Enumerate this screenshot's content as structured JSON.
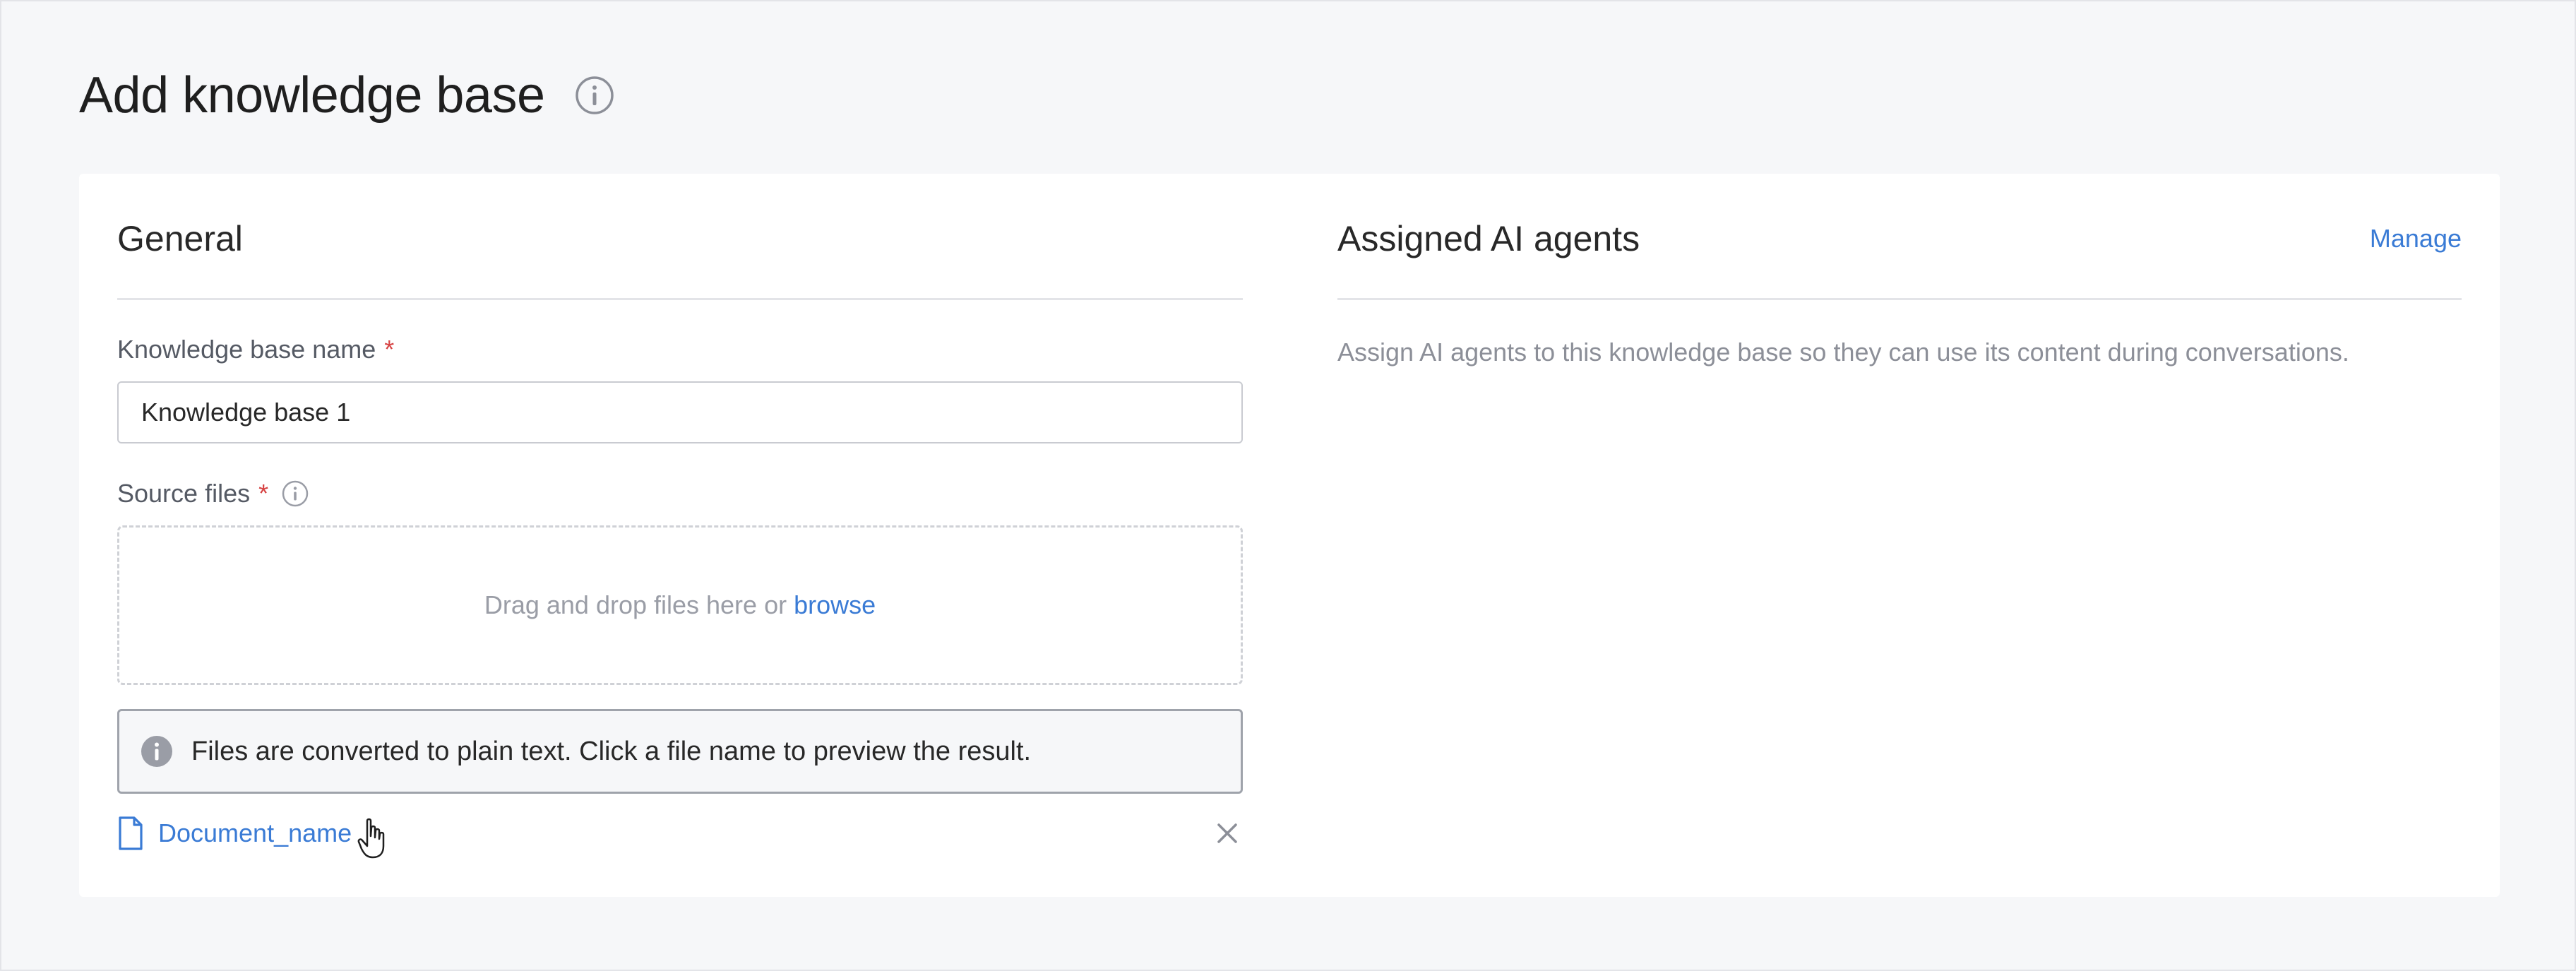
{
  "page": {
    "title": "Add knowledge base",
    "title_icon": "info-circle-icon"
  },
  "general": {
    "title": "General",
    "name_field": {
      "label": "Knowledge base name",
      "required_marker": "*",
      "value": "Knowledge base 1"
    },
    "source_files": {
      "label": "Source files",
      "required_marker": "*",
      "label_icon": "info-circle-icon",
      "dropzone_text": "Drag and drop files here or",
      "browse_label": "browse"
    },
    "notice": {
      "icon": "info-filled-icon",
      "text": "Files are converted to plain text. Click a file name to preview the result."
    },
    "files": [
      {
        "name": "Document_name",
        "icon": "document-icon",
        "remove_icon": "close-icon"
      }
    ]
  },
  "assigned_agents": {
    "title": "Assigned AI agents",
    "manage_label": "Manage",
    "description": "Assign AI agents to this knowledge base so they can use its content during conversations."
  },
  "colors": {
    "link": "#3a7bd5",
    "required": "#d64242",
    "background": "#f6f7f9",
    "card": "#ffffff"
  }
}
